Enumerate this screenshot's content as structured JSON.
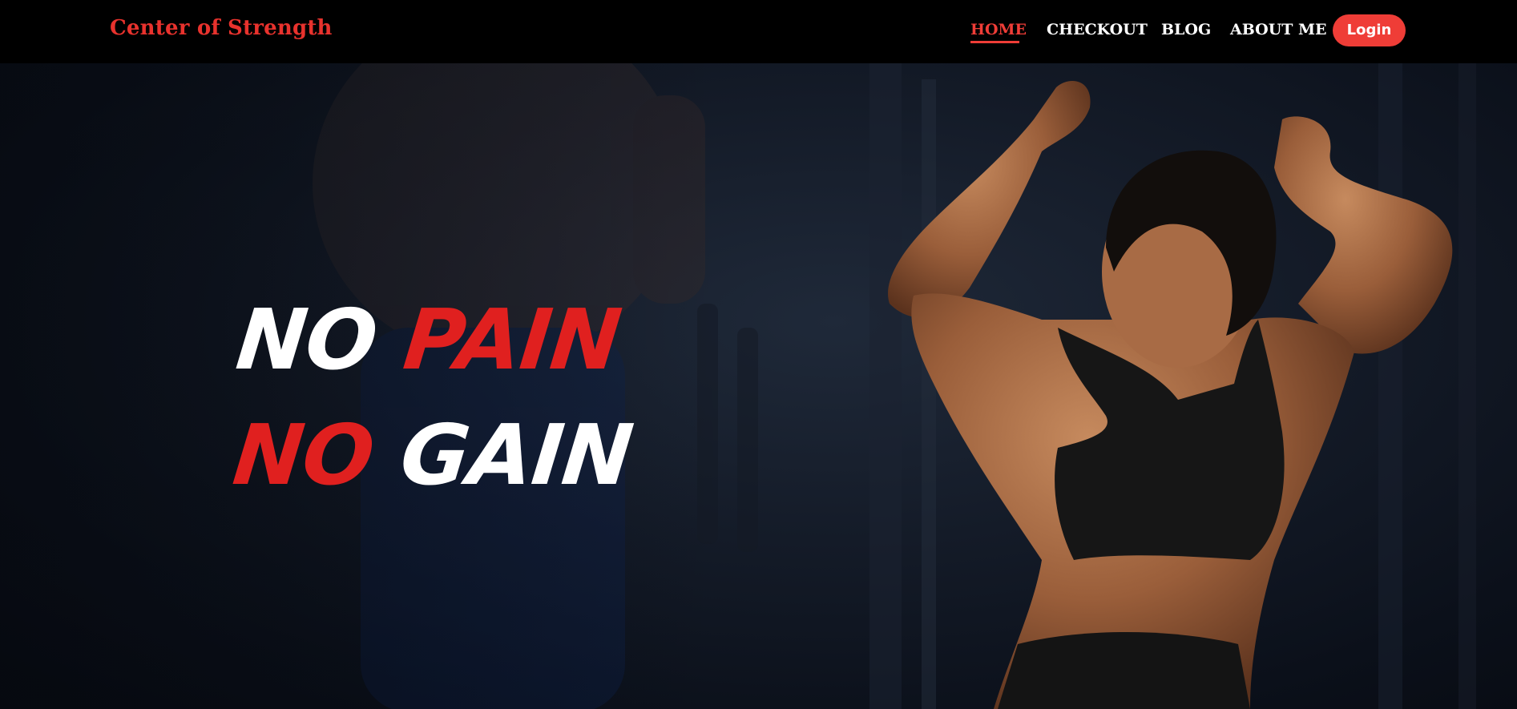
{
  "nav": {
    "brand": "Center of Strength",
    "links": [
      {
        "label": "HOME",
        "active": true
      },
      {
        "label": "CHECKOUT",
        "active": false
      },
      {
        "label": "BLOG",
        "active": false
      },
      {
        "label": "ABOUT ME",
        "active": false
      }
    ],
    "login_label": "Login"
  },
  "hero": {
    "line1": {
      "word1": "NO",
      "word2": "PAIN"
    },
    "line2": {
      "word1": "NO",
      "word2": "GAIN"
    },
    "image": "athlete-flexing-photo"
  },
  "colors": {
    "accent": "#ef3d37",
    "headline_red": "#e0201f",
    "navbar_bg": "#000000",
    "hero_bg": "#141b28"
  }
}
